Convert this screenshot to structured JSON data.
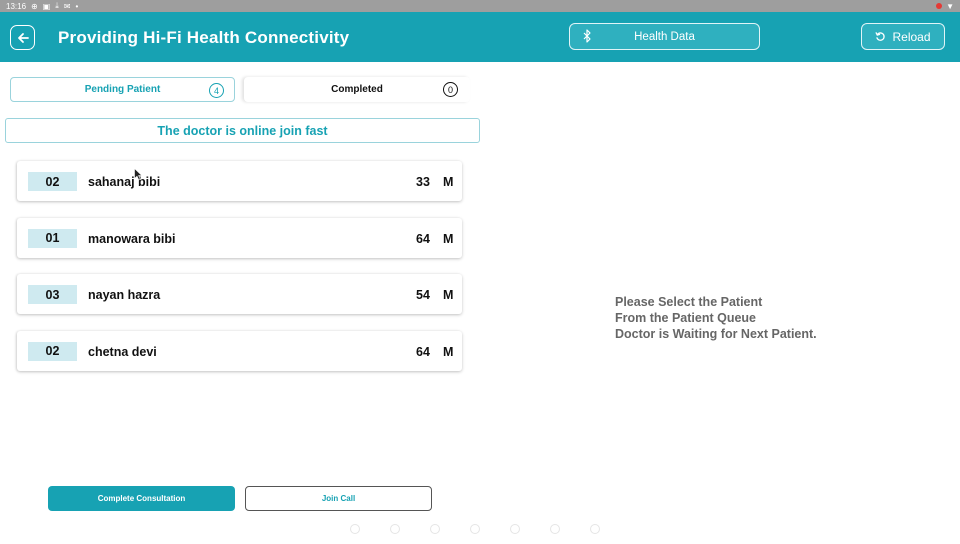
{
  "status_bar": {
    "time": "13:16",
    "icons": [
      "notification-icon",
      "image-icon",
      "download-icon",
      "mail-icon",
      "dot-icon"
    ],
    "right_icons": [
      "record-icon",
      "wifi-icon"
    ]
  },
  "app_bar": {
    "title": "Providing Hi-Fi Health Connectivity",
    "health_data_label": "Health Data",
    "reload_label": "Reload",
    "color": "#17a2b3"
  },
  "tabs": [
    {
      "label": "Pending Patient",
      "count": "4",
      "active": true
    },
    {
      "label": "Completed",
      "count": "0",
      "active": false
    }
  ],
  "notice": "The doctor is online join fast",
  "patients": [
    {
      "token": "02",
      "name": "sahanaj bibi",
      "age": "33",
      "sex": "M"
    },
    {
      "token": "01",
      "name": "manowara bibi",
      "age": "64",
      "sex": "M"
    },
    {
      "token": "03",
      "name": "nayan hazra",
      "age": "54",
      "sex": "M"
    },
    {
      "token": "02",
      "name": "chetna devi",
      "age": "64",
      "sex": "M"
    }
  ],
  "placeholder": {
    "line1": "Please Select the Patient",
    "line2": "From the Patient Queue",
    "line3": "Doctor is Waiting for Next Patient."
  },
  "actions": {
    "complete_label": "Complete Consultation",
    "join_call_label": "Join Call"
  }
}
